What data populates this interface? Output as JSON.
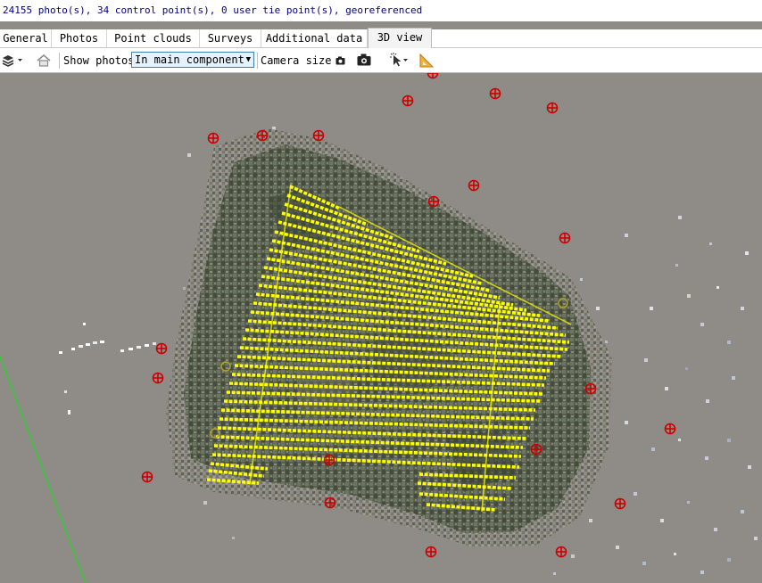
{
  "status": {
    "summary": "24155 photo(s), 34 control point(s), 0 user tie point(s), georeferenced"
  },
  "tabs": [
    {
      "label": "General"
    },
    {
      "label": "Photos"
    },
    {
      "label": "Point clouds"
    },
    {
      "label": "Surveys"
    },
    {
      "label": "Additional data"
    },
    {
      "label": "3D view",
      "active": true
    }
  ],
  "toolbar": {
    "layers_icon": "layers-icon",
    "home_icon": "home-icon",
    "show_photos_label": "Show photos",
    "show_photos_value": "In main component",
    "camera_size_label": "Camera size",
    "camera_small_icon": "camera-small-icon",
    "camera_large_icon": "camera-large-icon",
    "select_tool_icon": "cursor-select-icon",
    "measure_icon": "ruler-icon"
  },
  "viewport": {
    "background_color": "#8f8c87",
    "camera_color": "#ffff00",
    "control_point_color": "#cc0000",
    "axis_color": "#33cc33"
  }
}
